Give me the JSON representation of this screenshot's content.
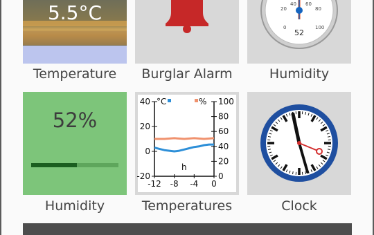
{
  "tiles": [
    {
      "label": "Temperature",
      "value": "5.5°C"
    },
    {
      "label": "Burglar Alarm",
      "icon": "bell-icon",
      "accent": "#c62828"
    },
    {
      "label": "Humidity",
      "gauge_value": "52",
      "gauge_ticks": [
        "20",
        "40",
        "60",
        "80",
        "100",
        "0"
      ]
    },
    {
      "label": "Humidity",
      "value": "52%",
      "fraction": 0.52
    },
    {
      "label": "Temperatures"
    },
    {
      "label": "Clock",
      "icon": "clock-icon"
    }
  ],
  "chart_data": {
    "type": "line",
    "left_unit": "°C",
    "right_unit": "%",
    "xlabel": "h",
    "x_ticks": [
      "-12",
      "-8",
      "-4",
      "0"
    ],
    "y_left_ticks": [
      "40",
      "20",
      "0",
      "-20"
    ],
    "y_right_ticks": [
      "100",
      "80",
      "60",
      "40",
      "20",
      "0"
    ],
    "y_left_range": [
      -20,
      40
    ],
    "y_right_range": [
      0,
      100
    ],
    "x_range": [
      -12,
      0
    ],
    "series": [
      {
        "axis": "left",
        "color": "#2d8fd8",
        "x": [
          -12,
          -11,
          -10,
          -9,
          -8,
          -7,
          -6,
          -5,
          -4,
          -3,
          -2,
          -1,
          0
        ],
        "y": [
          3,
          2,
          1,
          0.5,
          0,
          0.5,
          1.5,
          2.5,
          3.5,
          4,
          5,
          5.5,
          5.5
        ]
      },
      {
        "axis": "right",
        "color": "#f0926e",
        "x": [
          -12,
          -10,
          -8,
          -6,
          -4,
          -2,
          0
        ],
        "y": [
          50,
          50,
          51,
          50,
          51,
          50,
          51
        ]
      }
    ]
  }
}
